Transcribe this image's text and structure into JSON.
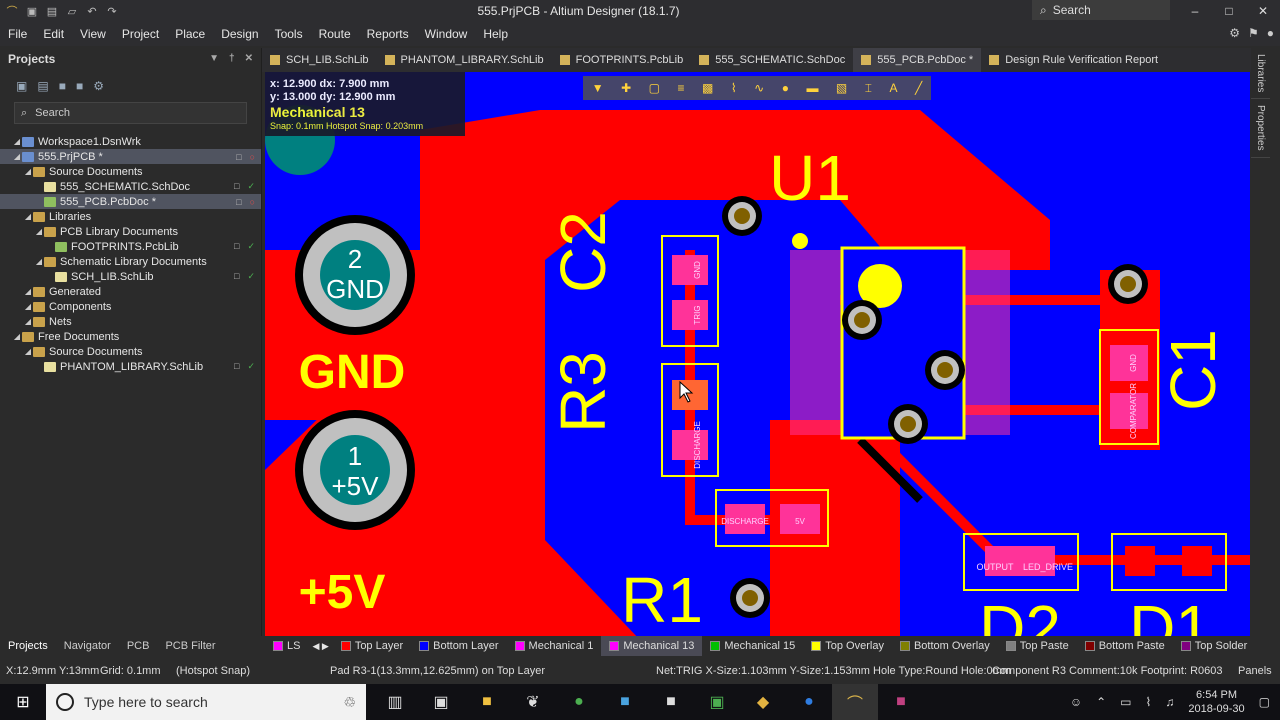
{
  "window": {
    "title": "555.PrjPCB - Altium Designer (18.1.7)",
    "search_placeholder": "Search"
  },
  "menu": [
    "File",
    "Edit",
    "View",
    "Project",
    "Place",
    "Design",
    "Tools",
    "Route",
    "Reports",
    "Window",
    "Help"
  ],
  "projects_panel": {
    "title": "Projects",
    "search_placeholder": "Search",
    "tree": [
      {
        "label": "Workspace1.DsnWrk",
        "level": 0,
        "type": "ws"
      },
      {
        "label": "555.PrjPCB *",
        "level": 0,
        "type": "proj"
      },
      {
        "label": "Source Documents",
        "level": 1,
        "type": "folder"
      },
      {
        "label": "555_SCHEMATIC.SchDoc",
        "level": 2,
        "type": "doc"
      },
      {
        "label": "555_PCB.PcbDoc *",
        "level": 2,
        "type": "pcb"
      },
      {
        "label": "Libraries",
        "level": 1,
        "type": "folder"
      },
      {
        "label": "PCB Library Documents",
        "level": 2,
        "type": "folder"
      },
      {
        "label": "FOOTPRINTS.PcbLib",
        "level": 3,
        "type": "pcb"
      },
      {
        "label": "Schematic Library Documents",
        "level": 2,
        "type": "folder"
      },
      {
        "label": "SCH_LIB.SchLib",
        "level": 3,
        "type": "doc"
      },
      {
        "label": "Generated",
        "level": 1,
        "type": "folder"
      },
      {
        "label": "Components",
        "level": 1,
        "type": "folder"
      },
      {
        "label": "Nets",
        "level": 1,
        "type": "folder"
      },
      {
        "label": "Free Documents",
        "level": 0,
        "type": "folder"
      },
      {
        "label": "Source Documents",
        "level": 1,
        "type": "folder"
      },
      {
        "label": "PHANTOM_LIBRARY.SchLib",
        "level": 2,
        "type": "doc"
      }
    ]
  },
  "doc_tabs": [
    "SCH_LIB.SchLib",
    "PHANTOM_LIBRARY.SchLib",
    "FOOTPRINTS.PcbLib",
    "555_SCHEMATIC.SchDoc",
    "555_PCB.PcbDoc *",
    "Design Rule Verification Report"
  ],
  "readout": {
    "line1": "x: 12.900   dx: 7.900  mm",
    "line2": "y: 13.000   dy: 12.900 mm",
    "layer": "Mechanical 13",
    "snap": "Snap: 0.1mm Hotspot Snap: 0.203mm"
  },
  "pcb_labels": {
    "u1": "U1",
    "c2": "C2",
    "r3": "R3",
    "c1": "C1",
    "r1": "R1",
    "d2": "D2",
    "d1": "D1",
    "gnd_pad": "GND",
    "gnd_num": "2",
    "v5_pad": "+5V",
    "v5_num": "1",
    "gnd_text": "GND",
    "v5_text": "+5V",
    "pad_trig": "TRIG",
    "pad_gnd": "GND",
    "pad_discharge": "DISCHARGE",
    "pad_output": "OUTPUT",
    "pad_led": "LED_DRIVE",
    "pad_5v": "5V",
    "pad_comparator": "COMPARATOR"
  },
  "bottom_panel_tabs": [
    "Projects",
    "Navigator",
    "PCB",
    "PCB Filter"
  ],
  "layer_tabs": [
    {
      "name": "LS",
      "color": "#ff00ff"
    },
    {
      "name": "Top Layer",
      "color": "#ff0000"
    },
    {
      "name": "Bottom Layer",
      "color": "#0000ff"
    },
    {
      "name": "Mechanical 1",
      "color": "#ff00ff"
    },
    {
      "name": "Mechanical 13",
      "color": "#ff00ff"
    },
    {
      "name": "Mechanical 15",
      "color": "#00c000"
    },
    {
      "name": "Top Overlay",
      "color": "#ffff00"
    },
    {
      "name": "Bottom Overlay",
      "color": "#808000"
    },
    {
      "name": "Top Paste",
      "color": "#808080"
    },
    {
      "name": "Bottom Paste",
      "color": "#800000"
    },
    {
      "name": "Top Solder",
      "color": "#800080"
    }
  ],
  "status": {
    "coords": "X:12.9mm Y:13mm",
    "grid": "Grid: 0.1mm",
    "hotspot": "(Hotspot Snap)",
    "pad": "Pad R3-1(13.3mm,12.625mm) on Top Layer",
    "net": "Net:TRIG X-Size:1.103mm Y-Size:1.153mm Hole Type:Round Hole:0mm",
    "component": "Component R3 Comment:10k Footprint: R0603",
    "panels": "Panels"
  },
  "right_panels": [
    "Libraries",
    "Properties"
  ],
  "taskbar": {
    "search": "Type here to search",
    "time": "6:54 PM",
    "date": "2018-09-30"
  }
}
